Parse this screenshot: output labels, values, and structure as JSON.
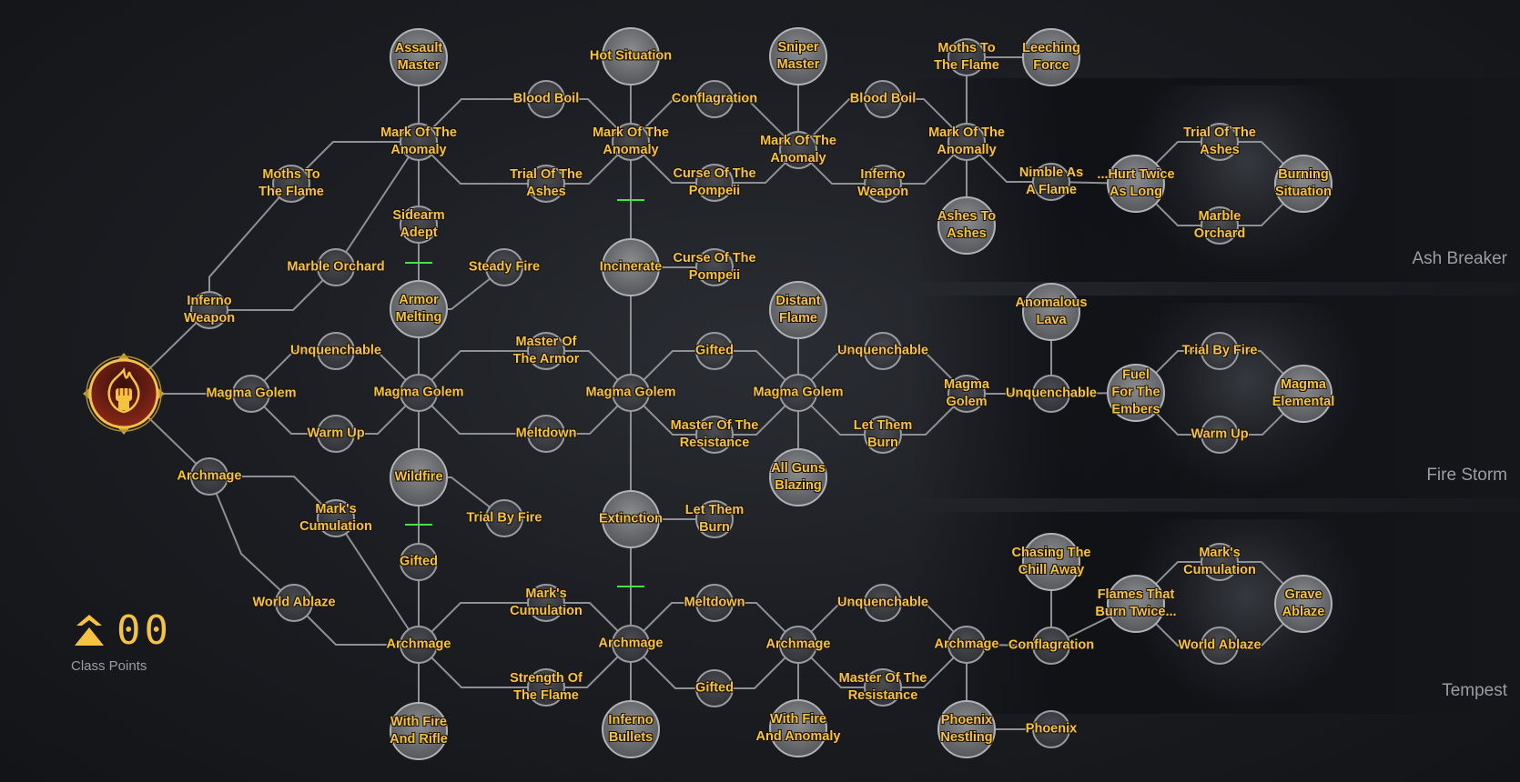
{
  "colors": {
    "accent": "#f5c242",
    "line": "#8e9094",
    "unlock_marker": "#4be04b",
    "root_fill": "#7a1e14"
  },
  "root": {
    "name": "class-root",
    "icon": "fist-flame-icon"
  },
  "class_points": {
    "value": "00",
    "label": "Class Points",
    "icon": "double-chevron-up-icon"
  },
  "panels": [
    {
      "id": "ash-breaker",
      "name": "Ash Breaker"
    },
    {
      "id": "fire-storm",
      "name": "Fire Storm"
    },
    {
      "id": "tempest",
      "name": "Tempest"
    }
  ],
  "nodes": [
    {
      "id": "inferno-weapon-1",
      "label": "Inferno\nWeapon",
      "size": "small"
    },
    {
      "id": "magma-golem-1",
      "label": "Magma Golem",
      "size": "small"
    },
    {
      "id": "archmage-1",
      "label": "Archmage",
      "size": "small"
    },
    {
      "id": "moths-to-the-flame-1",
      "label": "Moths To\nThe Flame",
      "size": "small"
    },
    {
      "id": "marble-orchard-1",
      "label": "Marble Orchard",
      "size": "small"
    },
    {
      "id": "unquenchable-1",
      "label": "Unquenchable",
      "size": "small"
    },
    {
      "id": "warm-up-1",
      "label": "Warm Up",
      "size": "small"
    },
    {
      "id": "marks-cumulation-1",
      "label": "Mark's\nCumulation",
      "size": "small"
    },
    {
      "id": "world-ablaze-1",
      "label": "World Ablaze",
      "size": "small"
    },
    {
      "id": "assault-master",
      "label": "Assault\nMaster",
      "size": "big"
    },
    {
      "id": "mark-of-the-anomaly-1",
      "label": "Mark Of The\nAnomaly",
      "size": "small"
    },
    {
      "id": "sidearm-adept",
      "label": "Sidearm\nAdept",
      "size": "small"
    },
    {
      "id": "armor-melting",
      "label": "Armor\nMelting",
      "size": "big"
    },
    {
      "id": "magma-golem-2",
      "label": "Magma Golem",
      "size": "small"
    },
    {
      "id": "wildfire",
      "label": "Wildfire",
      "size": "big"
    },
    {
      "id": "gifted-1",
      "label": "Gifted",
      "size": "small"
    },
    {
      "id": "archmage-2",
      "label": "Archmage",
      "size": "small"
    },
    {
      "id": "with-fire-and-rifle",
      "label": "With Fire\nAnd Rifle",
      "size": "big"
    },
    {
      "id": "blood-boil-1",
      "label": "Blood Boil",
      "size": "small"
    },
    {
      "id": "trial-of-the-ashes-1",
      "label": "Trial Of The\nAshes",
      "size": "small"
    },
    {
      "id": "steady-fire",
      "label": "Steady Fire",
      "size": "small"
    },
    {
      "id": "master-of-the-armor",
      "label": "Master Of\nThe Armor",
      "size": "small"
    },
    {
      "id": "meltdown-1",
      "label": "Meltdown",
      "size": "small"
    },
    {
      "id": "trial-by-fire-1",
      "label": "Trial By Fire",
      "size": "small"
    },
    {
      "id": "marks-cumulation-2",
      "label": "Mark's\nCumulation",
      "size": "small"
    },
    {
      "id": "strength-of-the-flame",
      "label": "Strength Of\nThe Flame",
      "size": "small"
    },
    {
      "id": "hot-situation",
      "label": "Hot Situation",
      "size": "big"
    },
    {
      "id": "mark-of-the-anomaly-2",
      "label": "Mark Of The\nAnomaly",
      "size": "small"
    },
    {
      "id": "incinerate",
      "label": "Incinerate",
      "size": "big"
    },
    {
      "id": "magma-golem-3",
      "label": "Magma Golem",
      "size": "small"
    },
    {
      "id": "extinction",
      "label": "Extinction",
      "size": "big"
    },
    {
      "id": "archmage-3",
      "label": "Archmage",
      "size": "small"
    },
    {
      "id": "inferno-bullets",
      "label": "Inferno\nBullets",
      "size": "big"
    },
    {
      "id": "conflagration-1",
      "label": "Conflagration",
      "size": "small"
    },
    {
      "id": "curse-of-the-pompeii-1",
      "label": "Curse Of The\nPompeii",
      "size": "small"
    },
    {
      "id": "curse-of-the-pompeii-2",
      "label": "Curse Of The\nPompeii",
      "size": "small"
    },
    {
      "id": "gifted-2",
      "label": "Gifted",
      "size": "small"
    },
    {
      "id": "master-of-the-resistance-1",
      "label": "Master Of The\nResistance",
      "size": "small"
    },
    {
      "id": "let-them-burn-1",
      "label": "Let Them\nBurn",
      "size": "small"
    },
    {
      "id": "meltdown-2",
      "label": "Meltdown",
      "size": "small"
    },
    {
      "id": "gifted-3",
      "label": "Gifted",
      "size": "small"
    },
    {
      "id": "sniper-master",
      "label": "Sniper\nMaster",
      "size": "big"
    },
    {
      "id": "mark-of-the-anomaly-3",
      "label": "Mark Of The\nAnomaly",
      "size": "small"
    },
    {
      "id": "distant-flame",
      "label": "Distant\nFlame",
      "size": "big"
    },
    {
      "id": "magma-golem-4",
      "label": "Magma Golem",
      "size": "small"
    },
    {
      "id": "all-guns-blazing",
      "label": "All Guns\nBlazing",
      "size": "big"
    },
    {
      "id": "archmage-4",
      "label": "Archmage",
      "size": "small"
    },
    {
      "id": "with-fire-and-anomaly",
      "label": "With Fire\nAnd Anomaly",
      "size": "big"
    },
    {
      "id": "blood-boil-2",
      "label": "Blood Boil",
      "size": "small"
    },
    {
      "id": "inferno-weapon-2",
      "label": "Inferno\nWeapon",
      "size": "small"
    },
    {
      "id": "unquenchable-2",
      "label": "Unquenchable",
      "size": "small"
    },
    {
      "id": "let-them-burn-2",
      "label": "Let Them\nBurn",
      "size": "small"
    },
    {
      "id": "unquenchable-3",
      "label": "Unquenchable",
      "size": "small"
    },
    {
      "id": "master-of-the-resistance-2",
      "label": "Master Of The\nResistance",
      "size": "small"
    },
    {
      "id": "moths-to-the-flame-2",
      "label": "Moths To\nThe Flame",
      "size": "small"
    },
    {
      "id": "mark-of-the-anomally",
      "label": "Mark Of The\nAnomally",
      "size": "small"
    },
    {
      "id": "ashes-to-ashes",
      "label": "Ashes To\nAshes",
      "size": "big"
    },
    {
      "id": "magma-golem-5",
      "label": "Magma\nGolem",
      "size": "small"
    },
    {
      "id": "archmage-5",
      "label": "Archmage",
      "size": "small"
    },
    {
      "id": "phoenix-nestling",
      "label": "Phoenix\nNestling",
      "size": "big"
    },
    {
      "id": "leeching-force",
      "label": "Leeching\nForce",
      "size": "big"
    },
    {
      "id": "nimble-as-a-flame",
      "label": "Nimble As\nA Flame",
      "size": "small"
    },
    {
      "id": "anomalous-lava",
      "label": "Anomalous\nLava",
      "size": "big"
    },
    {
      "id": "unquenchable-4",
      "label": "Unquenchable",
      "size": "small"
    },
    {
      "id": "chasing-the-chill-away",
      "label": "Chasing The\nChill Away",
      "size": "big"
    },
    {
      "id": "conflagration-2",
      "label": "Conflagration",
      "size": "small"
    },
    {
      "id": "phoenix",
      "label": "Phoenix",
      "size": "small"
    },
    {
      "id": "hurt-twice-as-long",
      "label": "...Hurt Twice\nAs Long",
      "size": "big"
    },
    {
      "id": "fuel-for-the-embers",
      "label": "Fuel\nFor The\nEmbers",
      "size": "big"
    },
    {
      "id": "flames-that-burn-twice",
      "label": "Flames That\nBurn Twice...",
      "size": "big"
    },
    {
      "id": "trial-of-the-ashes-2",
      "label": "Trial Of The\nAshes",
      "size": "small"
    },
    {
      "id": "marble-orchard-2",
      "label": "Marble\nOrchard",
      "size": "small"
    },
    {
      "id": "trial-by-fire-2",
      "label": "Trial By Fire",
      "size": "small"
    },
    {
      "id": "warm-up-2",
      "label": "Warm Up",
      "size": "small"
    },
    {
      "id": "marks-cumulation-3",
      "label": "Mark's\nCumulation",
      "size": "small"
    },
    {
      "id": "world-ablaze-2",
      "label": "World Ablaze",
      "size": "small"
    },
    {
      "id": "burning-situation",
      "label": "Burning\nSituation",
      "size": "big"
    },
    {
      "id": "magma-elemental",
      "label": "Magma\nElemental",
      "size": "big"
    },
    {
      "id": "grave-ablaze",
      "label": "Grave\nAblaze",
      "size": "big"
    }
  ]
}
